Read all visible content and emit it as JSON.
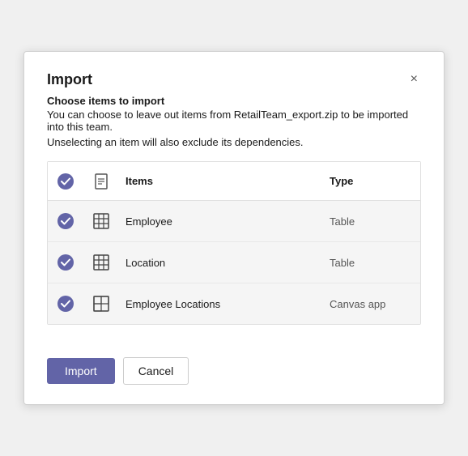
{
  "dialog": {
    "title": "Import",
    "close_label": "×",
    "subtitle_text": "Choose items to import",
    "description_part1": "You can choose to leave out items from ",
    "description_filename": "RetailTeam_export.zip",
    "description_part2": " to be imported into this team.",
    "description_line2": "Unselecting an item will also exclude its dependencies."
  },
  "table": {
    "headers": [
      {
        "key": "select",
        "label": ""
      },
      {
        "key": "icon",
        "label": ""
      },
      {
        "key": "items",
        "label": "Items"
      },
      {
        "key": "type",
        "label": "Type"
      }
    ],
    "rows": [
      {
        "id": 1,
        "name": "Employee",
        "type": "Table",
        "checked": true,
        "icon": "table"
      },
      {
        "id": 2,
        "name": "Location",
        "type": "Table",
        "checked": true,
        "icon": "table"
      },
      {
        "id": 3,
        "name": "Employee Locations",
        "type": "Canvas app",
        "checked": true,
        "icon": "canvas"
      }
    ]
  },
  "footer": {
    "import_label": "Import",
    "cancel_label": "Cancel"
  }
}
